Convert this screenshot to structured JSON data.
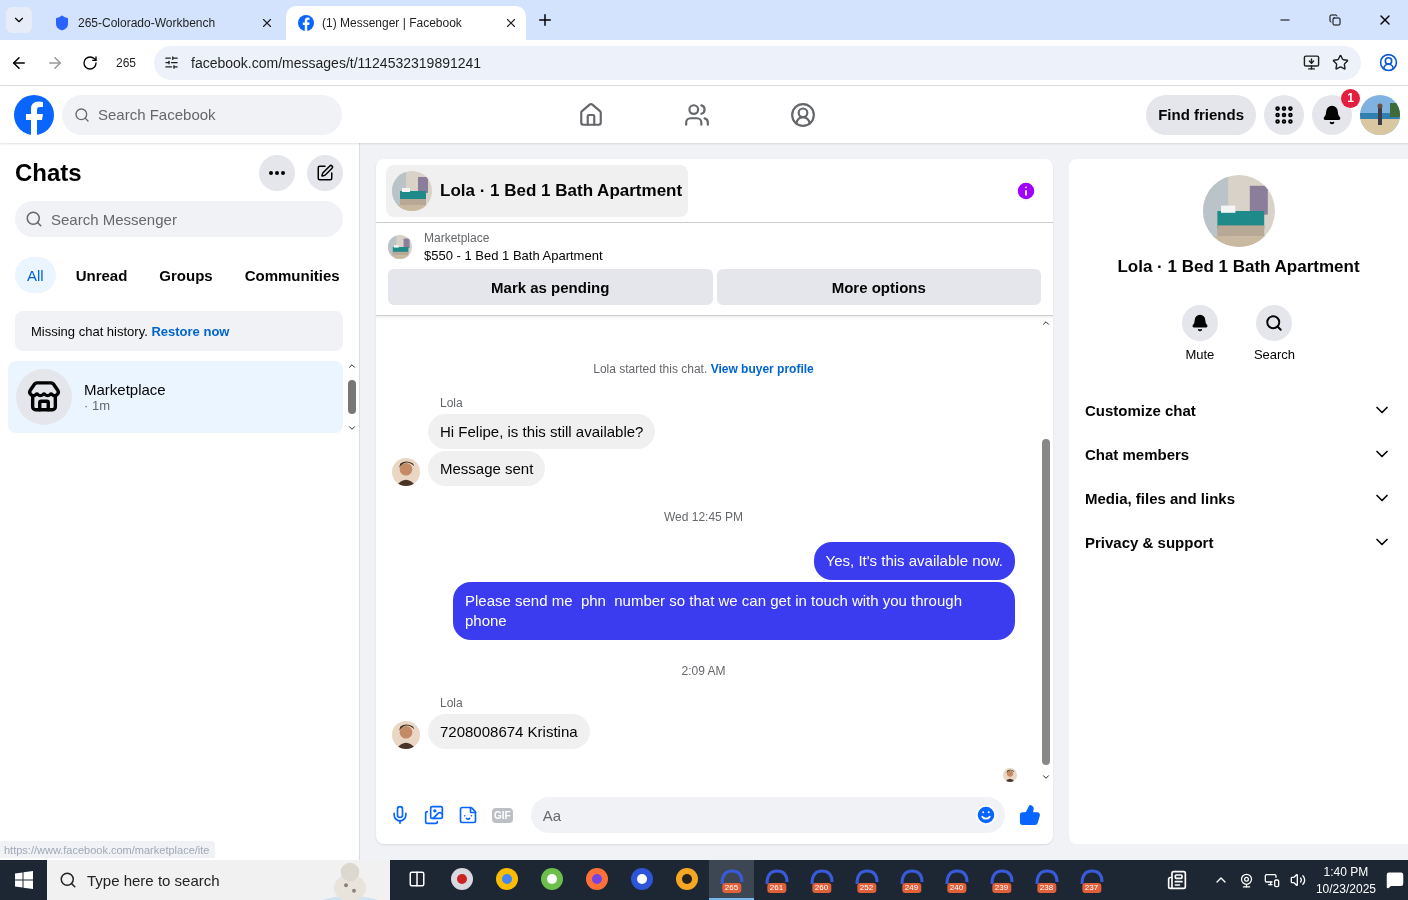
{
  "browser": {
    "tabs": [
      {
        "title": "265-Colorado-Workbench",
        "selected": false
      },
      {
        "title": "(1) Messenger | Facebook",
        "selected": true
      }
    ],
    "profile_label": "265",
    "url": "facebook.com/messages/t/1124532319891241"
  },
  "header": {
    "search": {
      "placeholder": "Search Facebook"
    },
    "find_friends": "Find friends",
    "notification_count": "1"
  },
  "sidebar": {
    "title": "Chats",
    "search": {
      "placeholder": "Search Messenger"
    },
    "filters": [
      {
        "label": "All",
        "selected": true
      },
      {
        "label": "Unread",
        "selected": false
      },
      {
        "label": "Groups",
        "selected": false
      },
      {
        "label": "Communities",
        "selected": false
      }
    ],
    "notice": {
      "text": "Missing chat history.",
      "link": "Restore now"
    },
    "chats": [
      {
        "name": "Marketplace",
        "time": "· 1m",
        "selected": true
      }
    ]
  },
  "status_url": "https://www.facebook.com/marketplace/ite",
  "conversation": {
    "title": "Lola · 1 Bed 1 Bath Apartment",
    "listing": {
      "source": "Marketplace",
      "title": "$550 - 1 Bed 1 Bath Apartment"
    },
    "actions": [
      "Mark as pending",
      "More options"
    ],
    "messages": [
      {
        "kind": "system",
        "text": "Lola started this chat.",
        "link": "View buyer profile"
      },
      {
        "kind": "sender",
        "text": "Lola"
      },
      {
        "kind": "incoming",
        "text": "Hi Felipe, is this still available?",
        "avatar": false
      },
      {
        "kind": "incoming",
        "text": "Message sent",
        "avatar": true
      },
      {
        "kind": "time",
        "text": "Wed 12:45 PM"
      },
      {
        "kind": "outgoing",
        "text": "Yes, It's this available now."
      },
      {
        "kind": "outgoing",
        "text": "Please send me  phn  number so that we can get in touch with you through phone"
      },
      {
        "kind": "time",
        "text": "2:09 AM"
      },
      {
        "kind": "sender",
        "text": "Lola"
      },
      {
        "kind": "incoming",
        "text": "7208008674 Kristina",
        "avatar": true
      }
    ],
    "composer": {
      "placeholder": "Aa",
      "gif": "GIF"
    }
  },
  "details": {
    "name": "Lola · 1 Bed 1 Bath Apartment",
    "actions": [
      "Mute",
      "Search"
    ],
    "sections": [
      {
        "label": "Customize chat",
        "expanded": false
      },
      {
        "label": "Chat members",
        "expanded": false
      },
      {
        "label": "Media, files and links",
        "expanded": false
      },
      {
        "label": "Privacy & support",
        "expanded": false
      }
    ]
  },
  "taskbar": {
    "search": {
      "placeholder": "Type here to search"
    },
    "apps": [
      "265",
      "261",
      "260",
      "252",
      "249",
      "240",
      "239",
      "238",
      "237"
    ],
    "time": "1:40 PM",
    "date": "10/23/2025"
  }
}
